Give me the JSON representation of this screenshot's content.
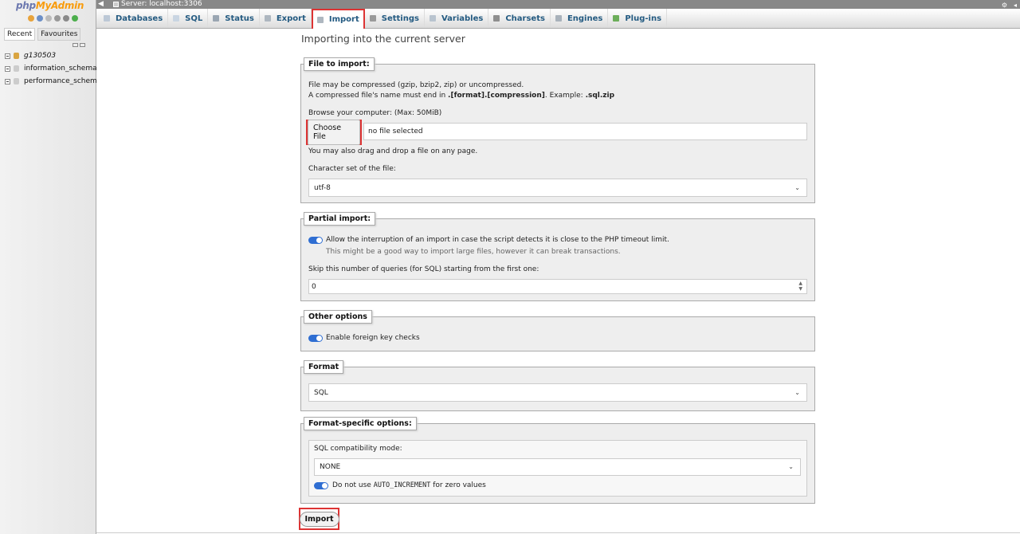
{
  "server_bar": {
    "text": "Server: localhost:3306"
  },
  "sidebar": {
    "logo": {
      "php": "php",
      "my": "My",
      "admin": "Admin"
    },
    "tabs": [
      "Recent",
      "Favourites"
    ],
    "databases": [
      "g130503",
      "information_schema",
      "performance_schema"
    ]
  },
  "tabs": [
    {
      "label": "Databases",
      "icon": "databases-icon"
    },
    {
      "label": "SQL",
      "icon": "sql-icon"
    },
    {
      "label": "Status",
      "icon": "status-icon"
    },
    {
      "label": "Export",
      "icon": "export-icon"
    },
    {
      "label": "Import",
      "icon": "import-icon",
      "active": true
    },
    {
      "label": "Settings",
      "icon": "settings-icon"
    },
    {
      "label": "Variables",
      "icon": "variables-icon"
    },
    {
      "label": "Charsets",
      "icon": "charsets-icon"
    },
    {
      "label": "Engines",
      "icon": "engines-icon"
    },
    {
      "label": "Plug-ins",
      "icon": "plugins-icon"
    }
  ],
  "page_title": "Importing into the current server",
  "file_import": {
    "legend": "File to import:",
    "line1": "File may be compressed (gzip, bzip2, zip) or uncompressed.",
    "line2_prefix": "A compressed file's name must end in ",
    "line2_bold": ".[format].[compression]",
    "line2_mid": ". Example: ",
    "line2_example": ".sql.zip",
    "browse_label": "Browse your computer: (Max: 50MiB)",
    "choose_button": "Choose File",
    "file_status": "no file selected",
    "drag_hint": "You may also drag and drop a file on any page.",
    "charset_label": "Character set of the file:",
    "charset_value": "utf-8"
  },
  "partial_import": {
    "legend": "Partial import:",
    "allow_interrupt": "Allow the interruption of an import in case the script detects it is close to the PHP timeout limit.",
    "allow_interrupt_hint": "This might be a good way to import large files, however it can break transactions.",
    "allow_interrupt_enabled": true,
    "skip_label": "Skip this number of queries (for SQL) starting from the first one:",
    "skip_value": "0"
  },
  "other_options": {
    "legend": "Other options",
    "foreign_keys": "Enable foreign key checks",
    "foreign_keys_enabled": true
  },
  "format": {
    "legend": "Format",
    "value": "SQL"
  },
  "format_specific": {
    "legend": "Format-specific options:",
    "compat_label": "SQL compatibility mode:",
    "compat_value": "NONE",
    "auto_inc_prefix": "Do not use ",
    "auto_inc_code": "AUTO_INCREMENT",
    "auto_inc_suffix": " for zero values",
    "auto_inc_enabled": true
  },
  "import_button": "Import",
  "colors": {
    "highlight": "#dd3333",
    "toggle": "#2f6ed2",
    "tab_text": "#235a81"
  }
}
